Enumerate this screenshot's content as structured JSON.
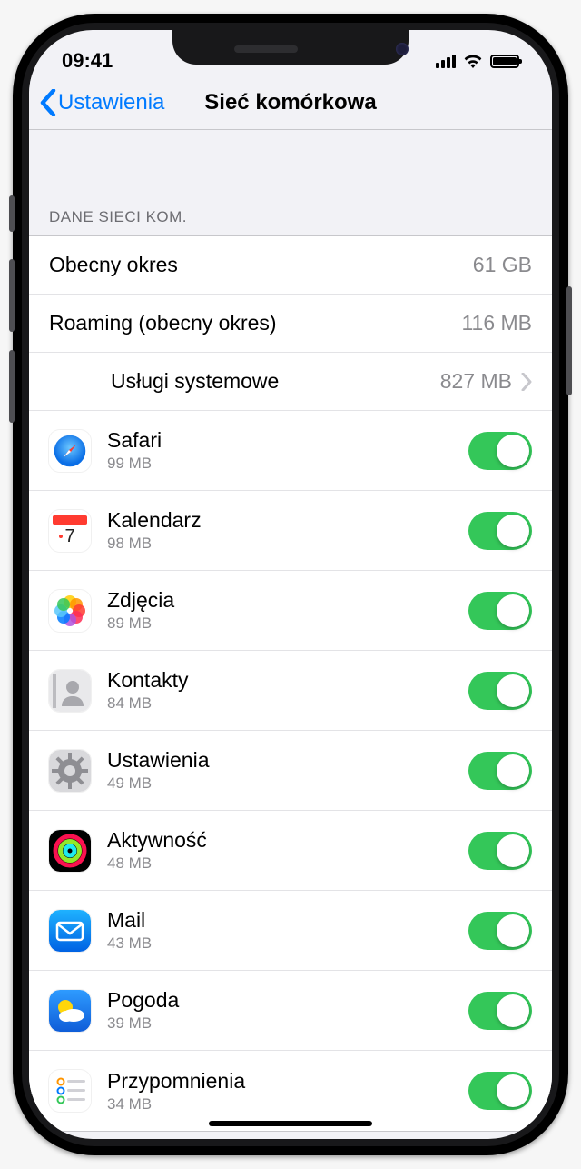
{
  "status": {
    "time": "09:41"
  },
  "nav": {
    "back": "Ustawienia",
    "title": "Sieć komórkowa"
  },
  "section_header": "Dane sieci kom.",
  "current_period": {
    "label": "Obecny okres",
    "value": "61 GB"
  },
  "roaming": {
    "label": "Roaming (obecny okres)",
    "value": "116 MB"
  },
  "system_services": {
    "label": "Usługi systemowe",
    "value": "827 MB"
  },
  "apps": [
    {
      "key": "safari",
      "name": "Safari",
      "usage": "99 MB",
      "on": true
    },
    {
      "key": "calendar",
      "name": "Kalendarz",
      "usage": "98 MB",
      "on": true
    },
    {
      "key": "photos",
      "name": "Zdjęcia",
      "usage": "89 MB",
      "on": true
    },
    {
      "key": "contacts",
      "name": "Kontakty",
      "usage": "84 MB",
      "on": true
    },
    {
      "key": "settings",
      "name": "Ustawienia",
      "usage": "49 MB",
      "on": true
    },
    {
      "key": "activity",
      "name": "Aktywność",
      "usage": "48 MB",
      "on": true
    },
    {
      "key": "mail",
      "name": "Mail",
      "usage": "43 MB",
      "on": true
    },
    {
      "key": "weather",
      "name": "Pogoda",
      "usage": "39 MB",
      "on": true
    },
    {
      "key": "reminders",
      "name": "Przypomnienia",
      "usage": "34 MB",
      "on": true
    }
  ],
  "colors": {
    "tint": "#007aff",
    "toggle_on": "#34c759"
  }
}
